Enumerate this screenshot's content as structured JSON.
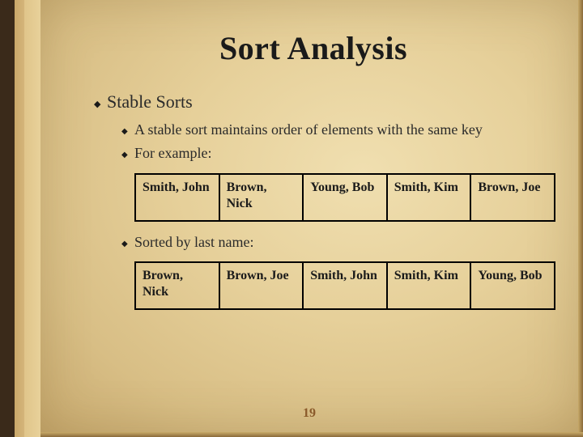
{
  "title": "Sort Analysis",
  "bullets": {
    "l1": "Stable Sorts",
    "l2a": "A stable sort maintains order of elements with the same key",
    "l2b": "For example:",
    "l2c": "Sorted by last name:"
  },
  "tables": {
    "unsorted": [
      "Smith, John",
      "Brown, Nick",
      "Young, Bob",
      "Smith, Kim",
      "Brown, Joe"
    ],
    "sorted": [
      "Brown, Nick",
      "Brown, Joe",
      "Smith, John",
      "Smith, Kim",
      "Young, Bob"
    ]
  },
  "page_number": "19"
}
